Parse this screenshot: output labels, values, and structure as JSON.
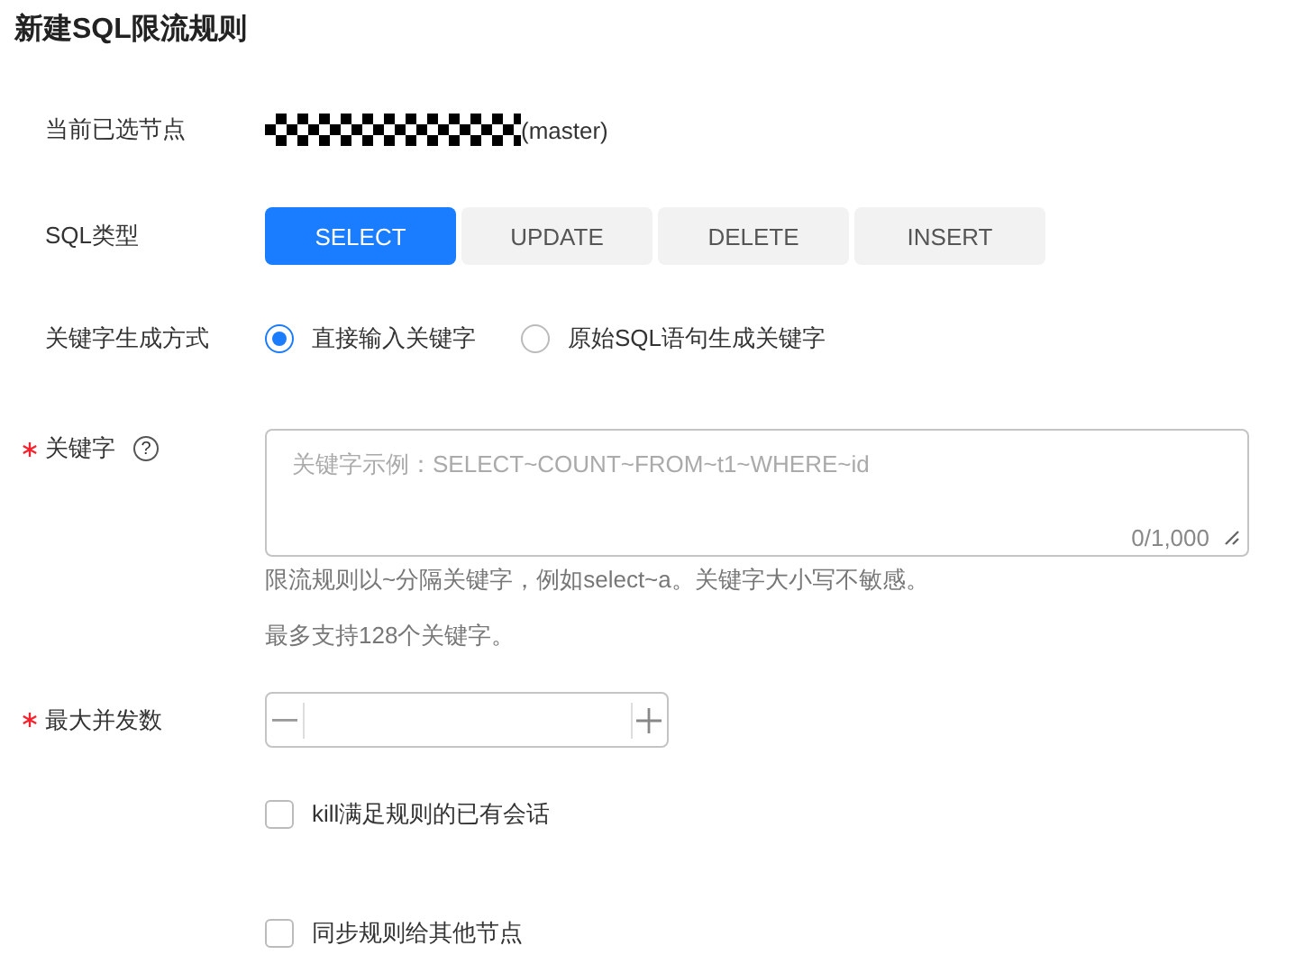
{
  "title": "新建SQL限流规则",
  "node": {
    "label": "当前已选节点",
    "suffix": "(master)"
  },
  "sql_type": {
    "label": "SQL类型",
    "options": [
      {
        "label": "SELECT",
        "selected": true
      },
      {
        "label": "UPDATE",
        "selected": false
      },
      {
        "label": "DELETE",
        "selected": false
      },
      {
        "label": "INSERT",
        "selected": false
      }
    ]
  },
  "keyword_mode": {
    "label": "关键字生成方式",
    "options": [
      {
        "label": "直接输入关键字",
        "selected": true
      },
      {
        "label": "原始SQL语句生成关键字",
        "selected": false
      }
    ]
  },
  "keyword": {
    "label": "关键字",
    "required": true,
    "help": "?",
    "placeholder": "关键字示例：SELECT~COUNT~FROM~t1~WHERE~id",
    "counter": "0/1,000",
    "hints": [
      "限流规则以~分隔关键字，例如select~a。关键字大小写不敏感。",
      "最多支持128个关键字。"
    ]
  },
  "max_concurrency": {
    "label": "最大并发数",
    "required": true
  },
  "checkboxes": [
    {
      "label": "kill满足规则的已有会话",
      "checked": false
    },
    {
      "label": "同步规则给其他节点",
      "checked": false
    }
  ]
}
